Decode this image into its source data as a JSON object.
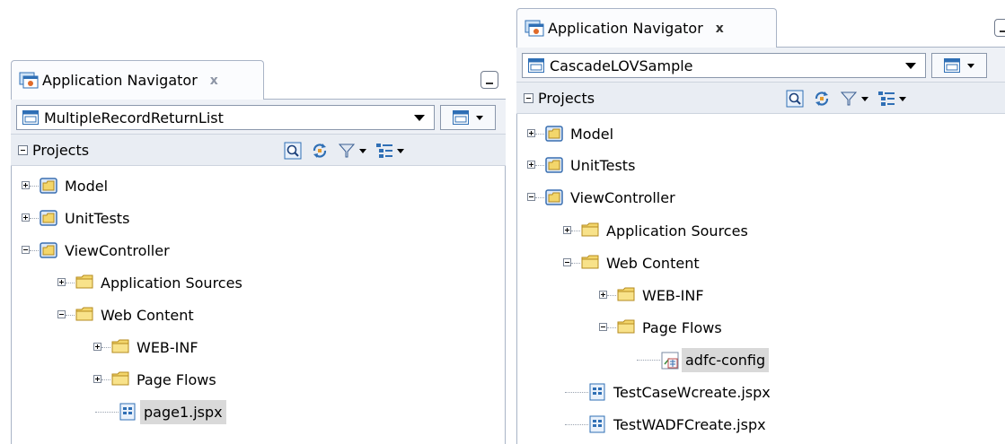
{
  "left_panel": {
    "tab": {
      "title": "Application Navigator",
      "close": "x",
      "icon": "application-navigator-icon"
    },
    "minimize_icon": "minimize-icon",
    "application": {
      "selected": "MultipleRecordReturnList",
      "icon": "application-icon"
    },
    "projects_label": "Projects",
    "toolbar_icons": [
      "search-icon",
      "refresh-icon",
      "filter-icon",
      "options-icon"
    ],
    "tree": [
      {
        "label": "Model",
        "type": "project",
        "expander": "plus"
      },
      {
        "label": "UnitTests",
        "type": "project",
        "expander": "plus"
      },
      {
        "label": "ViewController",
        "type": "project",
        "expander": "minus"
      },
      {
        "label": "Application Sources",
        "type": "folder",
        "expander": "plus"
      },
      {
        "label": "Web Content",
        "type": "folder",
        "expander": "minus"
      },
      {
        "label": "WEB-INF",
        "type": "folder",
        "expander": "plus"
      },
      {
        "label": "Page Flows",
        "type": "folder",
        "expander": "plus"
      },
      {
        "label": "page1.jspx",
        "type": "page",
        "selected": true
      }
    ]
  },
  "right_panel": {
    "tab": {
      "title": "Application Navigator",
      "close": "x",
      "icon": "application-navigator-icon"
    },
    "minimize_icon": "minimize-icon",
    "application": {
      "selected": "CascadeLOVSample",
      "icon": "application-icon"
    },
    "projects_label": "Projects",
    "toolbar_icons": [
      "search-icon",
      "refresh-icon",
      "filter-icon",
      "options-icon"
    ],
    "tree": [
      {
        "label": "Model",
        "type": "project",
        "expander": "plus"
      },
      {
        "label": "UnitTests",
        "type": "project",
        "expander": "plus"
      },
      {
        "label": "ViewController",
        "type": "project",
        "expander": "minus"
      },
      {
        "label": "Application Sources",
        "type": "folder",
        "expander": "plus"
      },
      {
        "label": "Web Content",
        "type": "folder",
        "expander": "minus"
      },
      {
        "label": "WEB-INF",
        "type": "folder",
        "expander": "plus"
      },
      {
        "label": "Page Flows",
        "type": "folder",
        "expander": "minus"
      },
      {
        "label": "adfc-config",
        "type": "taskflow",
        "selected": true
      },
      {
        "label": "TestCaseWcreate.jspx",
        "type": "page"
      },
      {
        "label": "TestWADFCreate.jspx",
        "type": "page"
      }
    ]
  },
  "colors": {
    "selection": "#d9d9d9",
    "folder": "#f3d66b",
    "project_border": "#3a6fb0"
  }
}
